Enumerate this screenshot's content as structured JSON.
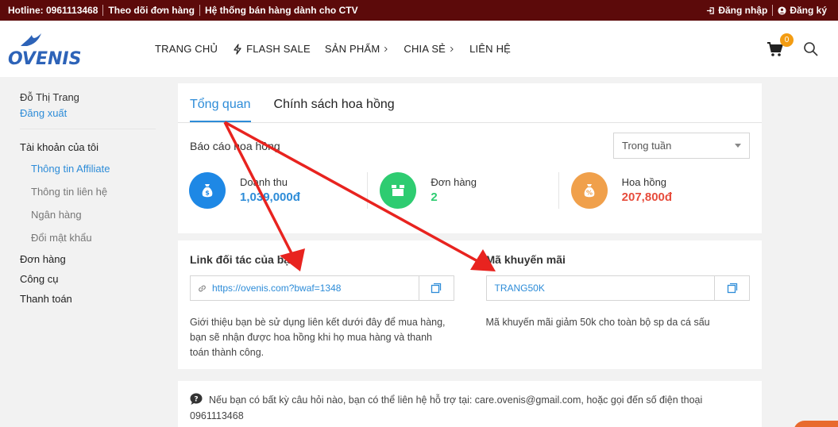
{
  "topbar": {
    "hotline": "Hotline: 0961113468",
    "track_order": "Theo dõi đơn hàng",
    "ctv_system": "Hệ thống bán hàng dành cho CTV",
    "login": "Đăng nhập",
    "register": "Đăng ký"
  },
  "header": {
    "logo_text": "OVENIS",
    "nav": [
      {
        "label": "TRANG CHỦ"
      },
      {
        "label": "FLASH SALE"
      },
      {
        "label": "SẢN PHẨM"
      },
      {
        "label": "CHIA SẺ"
      },
      {
        "label": "LIÊN HỆ"
      }
    ],
    "cart_count": "0"
  },
  "sidebar": {
    "user_name": "Đỗ Thị Trang",
    "logout": "Đăng xuất",
    "account": "Tài khoản của tôi",
    "sub_items": [
      {
        "label": "Thông tin Affiliate"
      },
      {
        "label": "Thông tin liên hệ"
      },
      {
        "label": "Ngân hàng"
      },
      {
        "label": "Đổi mật khẩu"
      }
    ],
    "orders": "Đơn hàng",
    "tools": "Công cụ",
    "payment": "Thanh toán"
  },
  "main": {
    "tabs": [
      {
        "label": "Tổng quan"
      },
      {
        "label": "Chính sách hoa hồng"
      }
    ],
    "report_title": "Báo cáo hoa hồng",
    "period": "Trong tuần",
    "stats": [
      {
        "label": "Doanh thu",
        "value": "1,039,000đ",
        "color": "#2d8cd8",
        "icon_bg": "#1e88e5"
      },
      {
        "label": "Đơn hàng",
        "value": "2",
        "color": "#2ecc71",
        "icon_bg": "#2ecc71"
      },
      {
        "label": "Hoa hồng",
        "value": "207,800đ",
        "color": "#e74c3c",
        "icon_bg": "#f0a04b"
      }
    ],
    "partner_link": {
      "title": "Link đối tác của bạn",
      "value": "https://ovenis.com?bwaf=1348",
      "desc": "Giới thiệu bạn bè sử dụng liên kết dưới đây để mua hàng, bạn sẽ nhận được hoa hồng khi họ mua hàng và thanh toán thành công."
    },
    "promo": {
      "title": "Mã khuyến mãi",
      "value": "TRANG50K",
      "desc": "Mã khuyến mãi giảm 50k cho toàn bộ sp da cá sấu"
    },
    "help": {
      "text": "Nếu bạn có bất kỳ câu hỏi nào, bạn có thể liên hệ hỗ trợ tại: care.ovenis@gmail.com, hoặc gọi đến số điện thoại",
      "phone": "0961113468"
    }
  },
  "colors": {
    "topbar": "#5c0a0a",
    "accent": "#2d8cd8",
    "arrow": "#e8231f"
  }
}
